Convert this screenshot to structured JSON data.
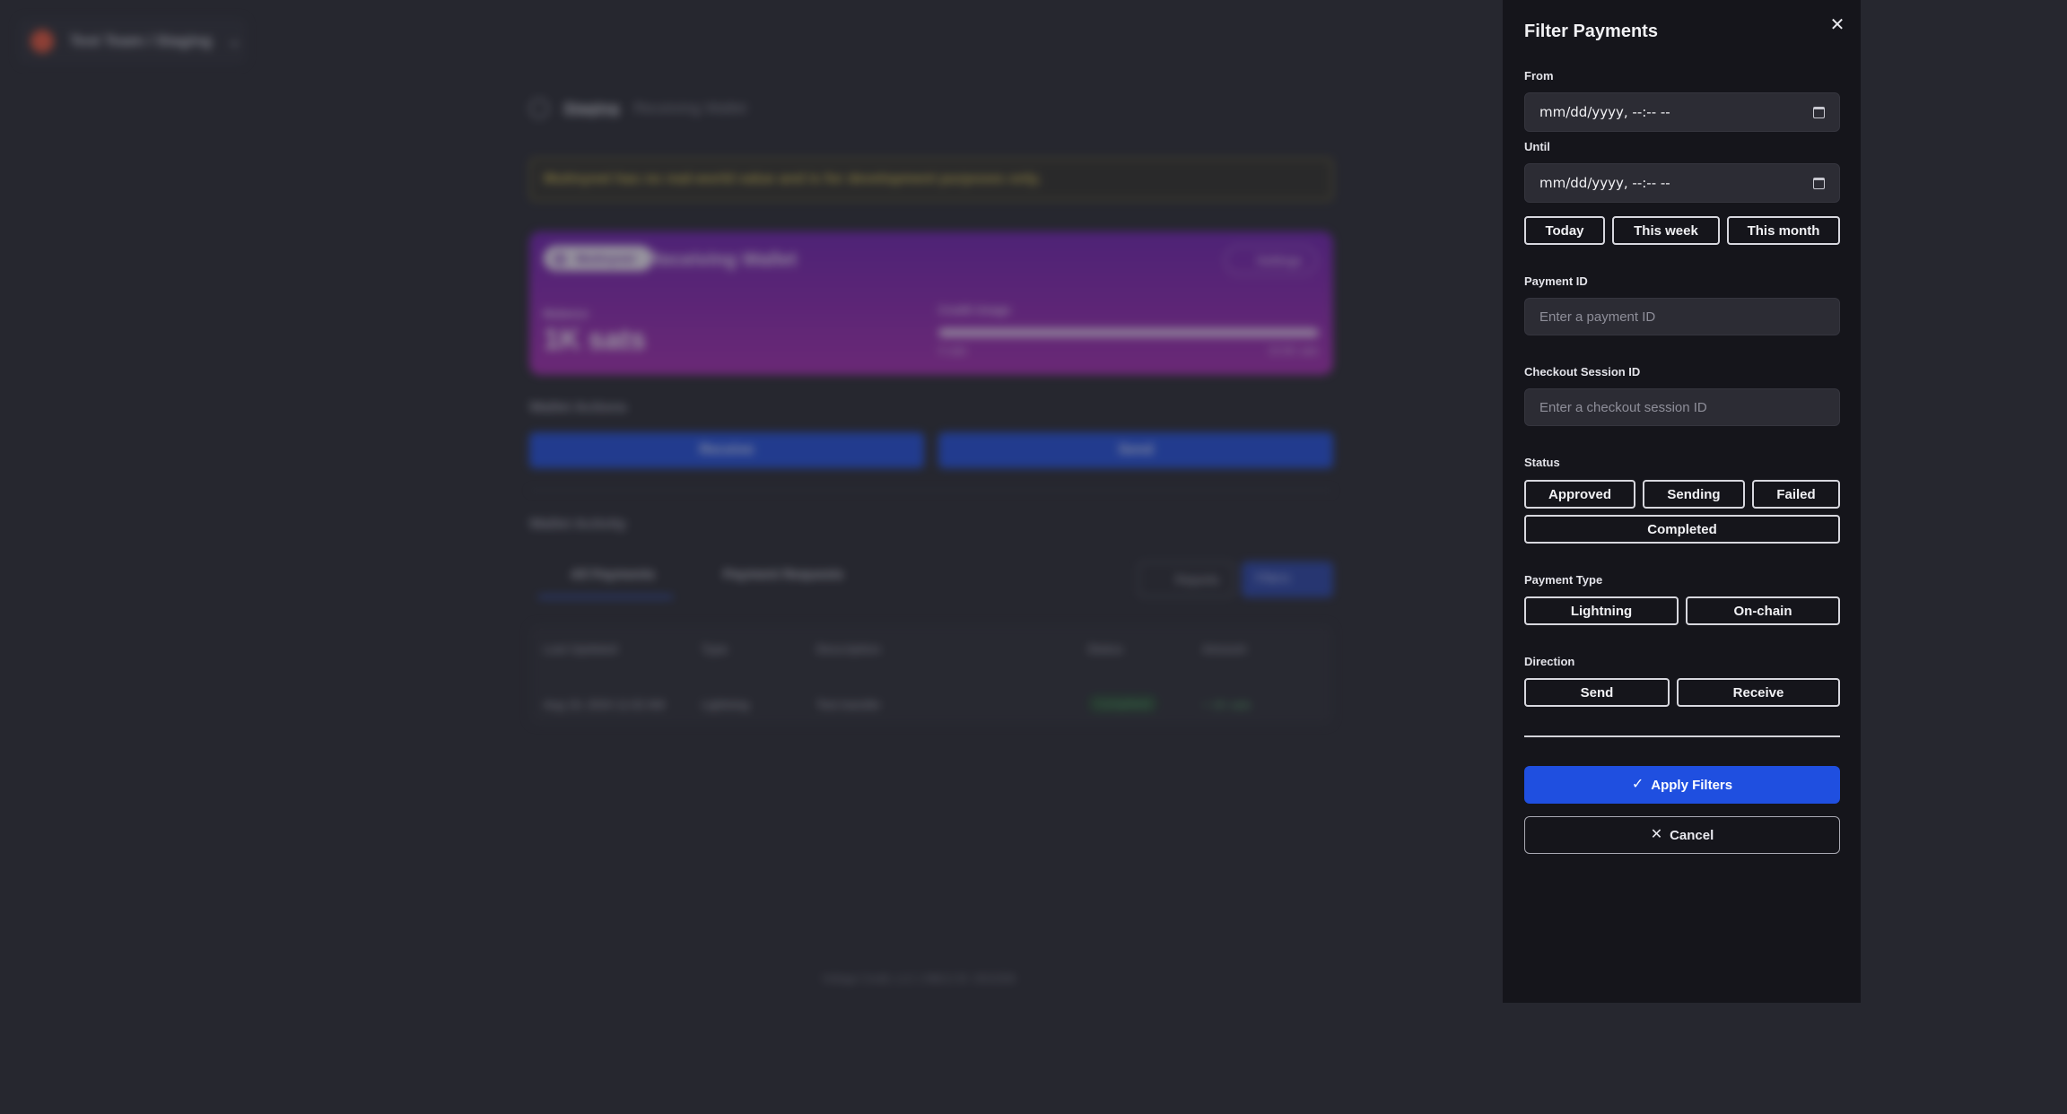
{
  "background": {
    "team_label": "Test Team  /  Staging",
    "breadcrumb": [
      "Staging",
      "Receiving Wallet"
    ],
    "notice": "Mutinynet has no real-world value and is for development purposes only.",
    "wallet": {
      "network_pill": "Mutinynet",
      "name": "Receiving Wallet",
      "settings_label": "Settings",
      "balance_label": "Balance",
      "balance": "1K sats",
      "credit_label": "Credit Usage",
      "credit_min": "0 sats",
      "credit_max": "10.5K sats"
    },
    "actions_title": "Wallet Actions",
    "receive_label": "Receive",
    "send_label": "Send",
    "activity_title": "Wallet Activity",
    "tabs": [
      "All Payments",
      "Payment Requests"
    ],
    "reports_label": "Reports",
    "filters_label": "Filters",
    "table": {
      "headers": [
        "Last Updated",
        "Type",
        "Description",
        "Status",
        "Amount"
      ],
      "row": [
        "Aug 19, 2024 11:02 AM",
        "Lightning",
        "Test transfer",
        "Completed",
        "+ 1K sats"
      ]
    },
    "footer": "Voltage Credit, LLC | NMLS ID: 2615256"
  },
  "drawer": {
    "title": "Filter Payments",
    "close_icon": "close-icon",
    "from_label": "From",
    "from_value": "mm/dd/yyyy, --:-- --",
    "until_label": "Until",
    "until_value": "mm/dd/yyyy, --:-- --",
    "quick_ranges": [
      "Today",
      "This week",
      "This month"
    ],
    "payment_id_label": "Payment ID",
    "payment_id_placeholder": "Enter a payment ID",
    "checkout_label": "Checkout Session ID",
    "checkout_placeholder": "Enter a checkout session ID",
    "status_label": "Status",
    "status_options": [
      "Approved",
      "Sending",
      "Failed",
      "Completed"
    ],
    "type_label": "Payment Type",
    "type_options": [
      "Lightning",
      "On-chain"
    ],
    "direction_label": "Direction",
    "direction_options": [
      "Send",
      "Receive"
    ],
    "apply_label": "Apply Filters",
    "cancel_label": "Cancel",
    "accent_color": "#1f4fe0"
  }
}
